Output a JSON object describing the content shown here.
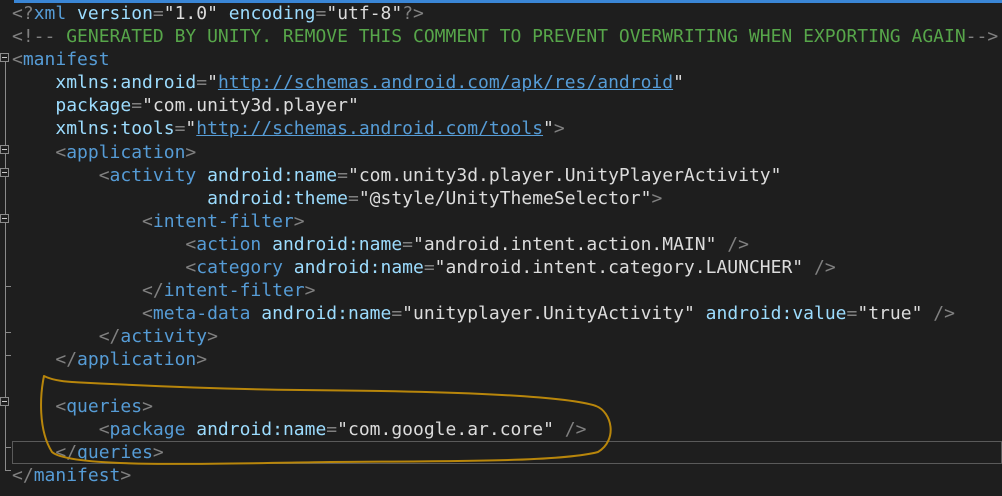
{
  "editor": {
    "lines": [
      [
        {
          "t": "<?",
          "c": "punc"
        },
        {
          "t": "xml",
          "c": "tag"
        },
        {
          "t": " ",
          "c": "plain"
        },
        {
          "t": "version",
          "c": "attr"
        },
        {
          "t": "=",
          "c": "punc"
        },
        {
          "t": "\"",
          "c": "q"
        },
        {
          "t": "1.0",
          "c": "str"
        },
        {
          "t": "\"",
          "c": "q"
        },
        {
          "t": " ",
          "c": "plain"
        },
        {
          "t": "encoding",
          "c": "attr"
        },
        {
          "t": "=",
          "c": "punc"
        },
        {
          "t": "\"",
          "c": "q"
        },
        {
          "t": "utf-8",
          "c": "str"
        },
        {
          "t": "\"",
          "c": "q"
        },
        {
          "t": "?>",
          "c": "punc"
        }
      ],
      [
        {
          "t": "<!--",
          "c": "punc"
        },
        {
          "t": " GENERATED BY UNITY. REMOVE THIS COMMENT TO PREVENT OVERWRITING WHEN EXPORTING AGAIN",
          "c": "comment"
        },
        {
          "t": "-->",
          "c": "punc"
        }
      ],
      [
        {
          "t": "<",
          "c": "punc"
        },
        {
          "t": "manifest",
          "c": "tag"
        }
      ],
      [
        {
          "t": "    ",
          "c": "plain"
        },
        {
          "t": "xmlns:android",
          "c": "attr"
        },
        {
          "t": "=",
          "c": "punc"
        },
        {
          "t": "\"",
          "c": "q"
        },
        {
          "t": "http://schemas.android.com/apk/res/android",
          "c": "link"
        },
        {
          "t": "\"",
          "c": "q"
        }
      ],
      [
        {
          "t": "    ",
          "c": "plain"
        },
        {
          "t": "package",
          "c": "attr"
        },
        {
          "t": "=",
          "c": "punc"
        },
        {
          "t": "\"",
          "c": "q"
        },
        {
          "t": "com.unity3d.player",
          "c": "str"
        },
        {
          "t": "\"",
          "c": "q"
        }
      ],
      [
        {
          "t": "    ",
          "c": "plain"
        },
        {
          "t": "xmlns:tools",
          "c": "attr"
        },
        {
          "t": "=",
          "c": "punc"
        },
        {
          "t": "\"",
          "c": "q"
        },
        {
          "t": "http://schemas.android.com/tools",
          "c": "link"
        },
        {
          "t": "\"",
          "c": "q"
        },
        {
          "t": ">",
          "c": "punc"
        }
      ],
      [
        {
          "t": "    ",
          "c": "plain"
        },
        {
          "t": "<",
          "c": "punc"
        },
        {
          "t": "application",
          "c": "tag"
        },
        {
          "t": ">",
          "c": "punc"
        }
      ],
      [
        {
          "t": "        ",
          "c": "plain"
        },
        {
          "t": "<",
          "c": "punc"
        },
        {
          "t": "activity",
          "c": "tag"
        },
        {
          "t": " ",
          "c": "plain"
        },
        {
          "t": "android:name",
          "c": "attr"
        },
        {
          "t": "=",
          "c": "punc"
        },
        {
          "t": "\"",
          "c": "q"
        },
        {
          "t": "com.unity3d.player.UnityPlayerActivity",
          "c": "str"
        },
        {
          "t": "\"",
          "c": "q"
        }
      ],
      [
        {
          "t": "                  ",
          "c": "plain"
        },
        {
          "t": "android:theme",
          "c": "attr"
        },
        {
          "t": "=",
          "c": "punc"
        },
        {
          "t": "\"",
          "c": "q"
        },
        {
          "t": "@style/UnityThemeSelector",
          "c": "str"
        },
        {
          "t": "\"",
          "c": "q"
        },
        {
          "t": ">",
          "c": "punc"
        }
      ],
      [
        {
          "t": "            ",
          "c": "plain"
        },
        {
          "t": "<",
          "c": "punc"
        },
        {
          "t": "intent-filter",
          "c": "tag"
        },
        {
          "t": ">",
          "c": "punc"
        }
      ],
      [
        {
          "t": "                ",
          "c": "plain"
        },
        {
          "t": "<",
          "c": "punc"
        },
        {
          "t": "action",
          "c": "tag"
        },
        {
          "t": " ",
          "c": "plain"
        },
        {
          "t": "android:name",
          "c": "attr"
        },
        {
          "t": "=",
          "c": "punc"
        },
        {
          "t": "\"",
          "c": "q"
        },
        {
          "t": "android.intent.action.MAIN",
          "c": "str"
        },
        {
          "t": "\"",
          "c": "q"
        },
        {
          "t": " />",
          "c": "punc"
        }
      ],
      [
        {
          "t": "                ",
          "c": "plain"
        },
        {
          "t": "<",
          "c": "punc"
        },
        {
          "t": "category",
          "c": "tag"
        },
        {
          "t": " ",
          "c": "plain"
        },
        {
          "t": "android:name",
          "c": "attr"
        },
        {
          "t": "=",
          "c": "punc"
        },
        {
          "t": "\"",
          "c": "q"
        },
        {
          "t": "android.intent.category.LAUNCHER",
          "c": "str"
        },
        {
          "t": "\"",
          "c": "q"
        },
        {
          "t": " />",
          "c": "punc"
        }
      ],
      [
        {
          "t": "            ",
          "c": "plain"
        },
        {
          "t": "</",
          "c": "punc"
        },
        {
          "t": "intent-filter",
          "c": "tag"
        },
        {
          "t": ">",
          "c": "punc"
        }
      ],
      [
        {
          "t": "            ",
          "c": "plain"
        },
        {
          "t": "<",
          "c": "punc"
        },
        {
          "t": "meta-data",
          "c": "tag"
        },
        {
          "t": " ",
          "c": "plain"
        },
        {
          "t": "android:name",
          "c": "attr"
        },
        {
          "t": "=",
          "c": "punc"
        },
        {
          "t": "\"",
          "c": "q"
        },
        {
          "t": "unityplayer.UnityActivity",
          "c": "str"
        },
        {
          "t": "\"",
          "c": "q"
        },
        {
          "t": " ",
          "c": "plain"
        },
        {
          "t": "android:value",
          "c": "attr"
        },
        {
          "t": "=",
          "c": "punc"
        },
        {
          "t": "\"",
          "c": "q"
        },
        {
          "t": "true",
          "c": "str"
        },
        {
          "t": "\"",
          "c": "q"
        },
        {
          "t": " />",
          "c": "punc"
        }
      ],
      [
        {
          "t": "        ",
          "c": "plain"
        },
        {
          "t": "</",
          "c": "punc"
        },
        {
          "t": "activity",
          "c": "tag"
        },
        {
          "t": ">",
          "c": "punc"
        }
      ],
      [
        {
          "t": "    ",
          "c": "plain"
        },
        {
          "t": "</",
          "c": "punc"
        },
        {
          "t": "application",
          "c": "tag"
        },
        {
          "t": ">",
          "c": "punc"
        }
      ],
      [],
      [
        {
          "t": "    ",
          "c": "plain"
        },
        {
          "t": "<",
          "c": "punc"
        },
        {
          "t": "queries",
          "c": "tag"
        },
        {
          "t": ">",
          "c": "punc"
        }
      ],
      [
        {
          "t": "        ",
          "c": "plain"
        },
        {
          "t": "<",
          "c": "punc"
        },
        {
          "t": "package",
          "c": "tag"
        },
        {
          "t": " ",
          "c": "plain"
        },
        {
          "t": "android:name",
          "c": "attr"
        },
        {
          "t": "=",
          "c": "punc"
        },
        {
          "t": "\"",
          "c": "q"
        },
        {
          "t": "com.google.ar.core",
          "c": "str"
        },
        {
          "t": "\"",
          "c": "q"
        },
        {
          "t": " />",
          "c": "punc"
        }
      ],
      [
        {
          "t": "    ",
          "c": "plain"
        },
        {
          "t": "</",
          "c": "punc"
        },
        {
          "t": "queries",
          "c": "tag"
        },
        {
          "t": ">",
          "c": "punc"
        }
      ],
      [
        {
          "t": "</",
          "c": "punc"
        },
        {
          "t": "manifest",
          "c": "tag"
        },
        {
          "t": ">",
          "c": "punc"
        }
      ]
    ],
    "current_line": 19
  },
  "colors": {
    "background": "#1e1e1e",
    "tag": "#569cd6",
    "attribute": "#9cdcfe",
    "comment": "#57a64a",
    "punctuation": "#808080",
    "annotation": "#b8860b"
  }
}
